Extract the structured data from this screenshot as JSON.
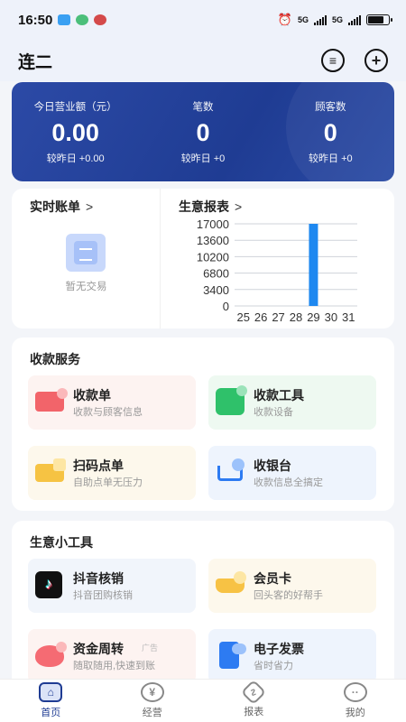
{
  "status": {
    "time": "16:50",
    "net1": "5G",
    "net2": "5G"
  },
  "header": {
    "title": "连二"
  },
  "summary": [
    {
      "label": "今日营业额（元）",
      "value": "0.00",
      "change": "较昨日 +0.00"
    },
    {
      "label": "笔数",
      "value": "0",
      "change": "较昨日 +0"
    },
    {
      "label": "顾客数",
      "value": "0",
      "change": "较昨日 +0"
    }
  ],
  "overview": {
    "bills": {
      "title": "实时账单",
      "chevron": ">",
      "empty": "暂无交易"
    },
    "report": {
      "title": "生意报表",
      "chevron": ">"
    }
  },
  "chart_data": {
    "type": "bar",
    "categories": [
      "25",
      "26",
      "27",
      "28",
      "29",
      "30",
      "31"
    ],
    "values": [
      0,
      0,
      0,
      0,
      17000,
      0,
      0
    ],
    "yticks": [
      0,
      3400,
      6800,
      10200,
      13600,
      17000
    ],
    "ylim": [
      0,
      17000
    ],
    "color": "#1e88f0",
    "grid": true
  },
  "services": {
    "title": "收款服务",
    "items": [
      {
        "title": "收款单",
        "sub": "收款与顾客信息",
        "icon": "receipt-icon"
      },
      {
        "title": "收款工具",
        "sub": "收款设备",
        "icon": "device-icon"
      },
      {
        "title": "扫码点单",
        "sub": "自助点单无压力",
        "icon": "scan-order-icon"
      },
      {
        "title": "收银台",
        "sub": "收款信息全搞定",
        "icon": "cashier-icon"
      }
    ]
  },
  "tools": {
    "title": "生意小工具",
    "items": [
      {
        "title": "抖音核销",
        "sub": "抖音团购核销",
        "icon": "douyin-icon",
        "glyph": "♪"
      },
      {
        "title": "会员卡",
        "sub": "回头客的好帮手",
        "icon": "member-card-icon"
      },
      {
        "title": "资金周转",
        "sub": "随取随用,快速到账",
        "icon": "money-icon",
        "tag": "广告"
      },
      {
        "title": "电子发票",
        "sub": "省时省力",
        "icon": "invoice-icon"
      }
    ]
  },
  "tabs": [
    {
      "label": "首页",
      "glyph": "⌂"
    },
    {
      "label": "经营",
      "glyph": "¥"
    },
    {
      "label": "报表",
      "glyph": "∿"
    },
    {
      "label": "我的",
      "glyph": "··"
    }
  ]
}
